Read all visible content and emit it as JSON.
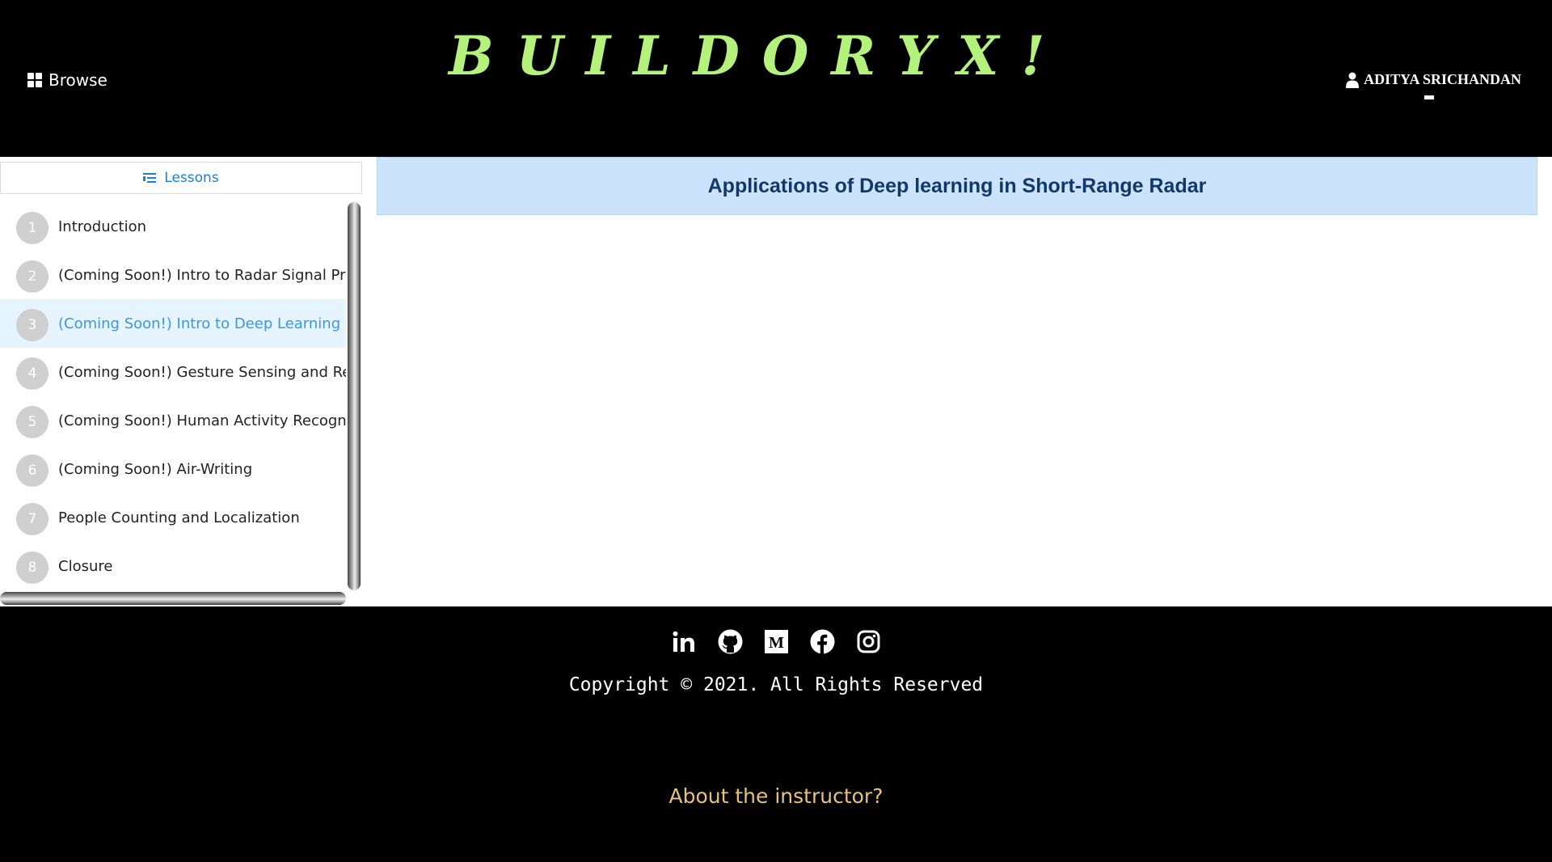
{
  "header": {
    "browse_label": "Browse",
    "brand": "BUILDORYX!",
    "user_name": "ADITYA SRICHANDAN",
    "brand_color": "#b5f27c"
  },
  "sidebar": {
    "lessons_button": "Lessons",
    "items": [
      {
        "num": "1",
        "label": "Introduction"
      },
      {
        "num": "2",
        "label": "(Coming Soon!) Intro to Radar Signal Pro"
      },
      {
        "num": "3",
        "label": "(Coming Soon!) Intro to Deep Learning",
        "active": true
      },
      {
        "num": "4",
        "label": "(Coming Soon!) Gesture Sensing and Recog"
      },
      {
        "num": "5",
        "label": "(Coming Soon!) Human Activity Recognitio"
      },
      {
        "num": "6",
        "label": "(Coming Soon!) Air-Writing"
      },
      {
        "num": "7",
        "label": "People Counting and Localization"
      },
      {
        "num": "8",
        "label": "Closure"
      }
    ]
  },
  "content": {
    "title": "Applications of Deep learning in Short-Range Radar"
  },
  "footer": {
    "socials": [
      "linkedin-icon",
      "github-icon",
      "medium-icon",
      "facebook-icon",
      "instagram-icon"
    ],
    "copyright": "Copyright © 2021. All Rights Reserved",
    "about": "About the instructor?",
    "about_color": "#e6c27a"
  }
}
